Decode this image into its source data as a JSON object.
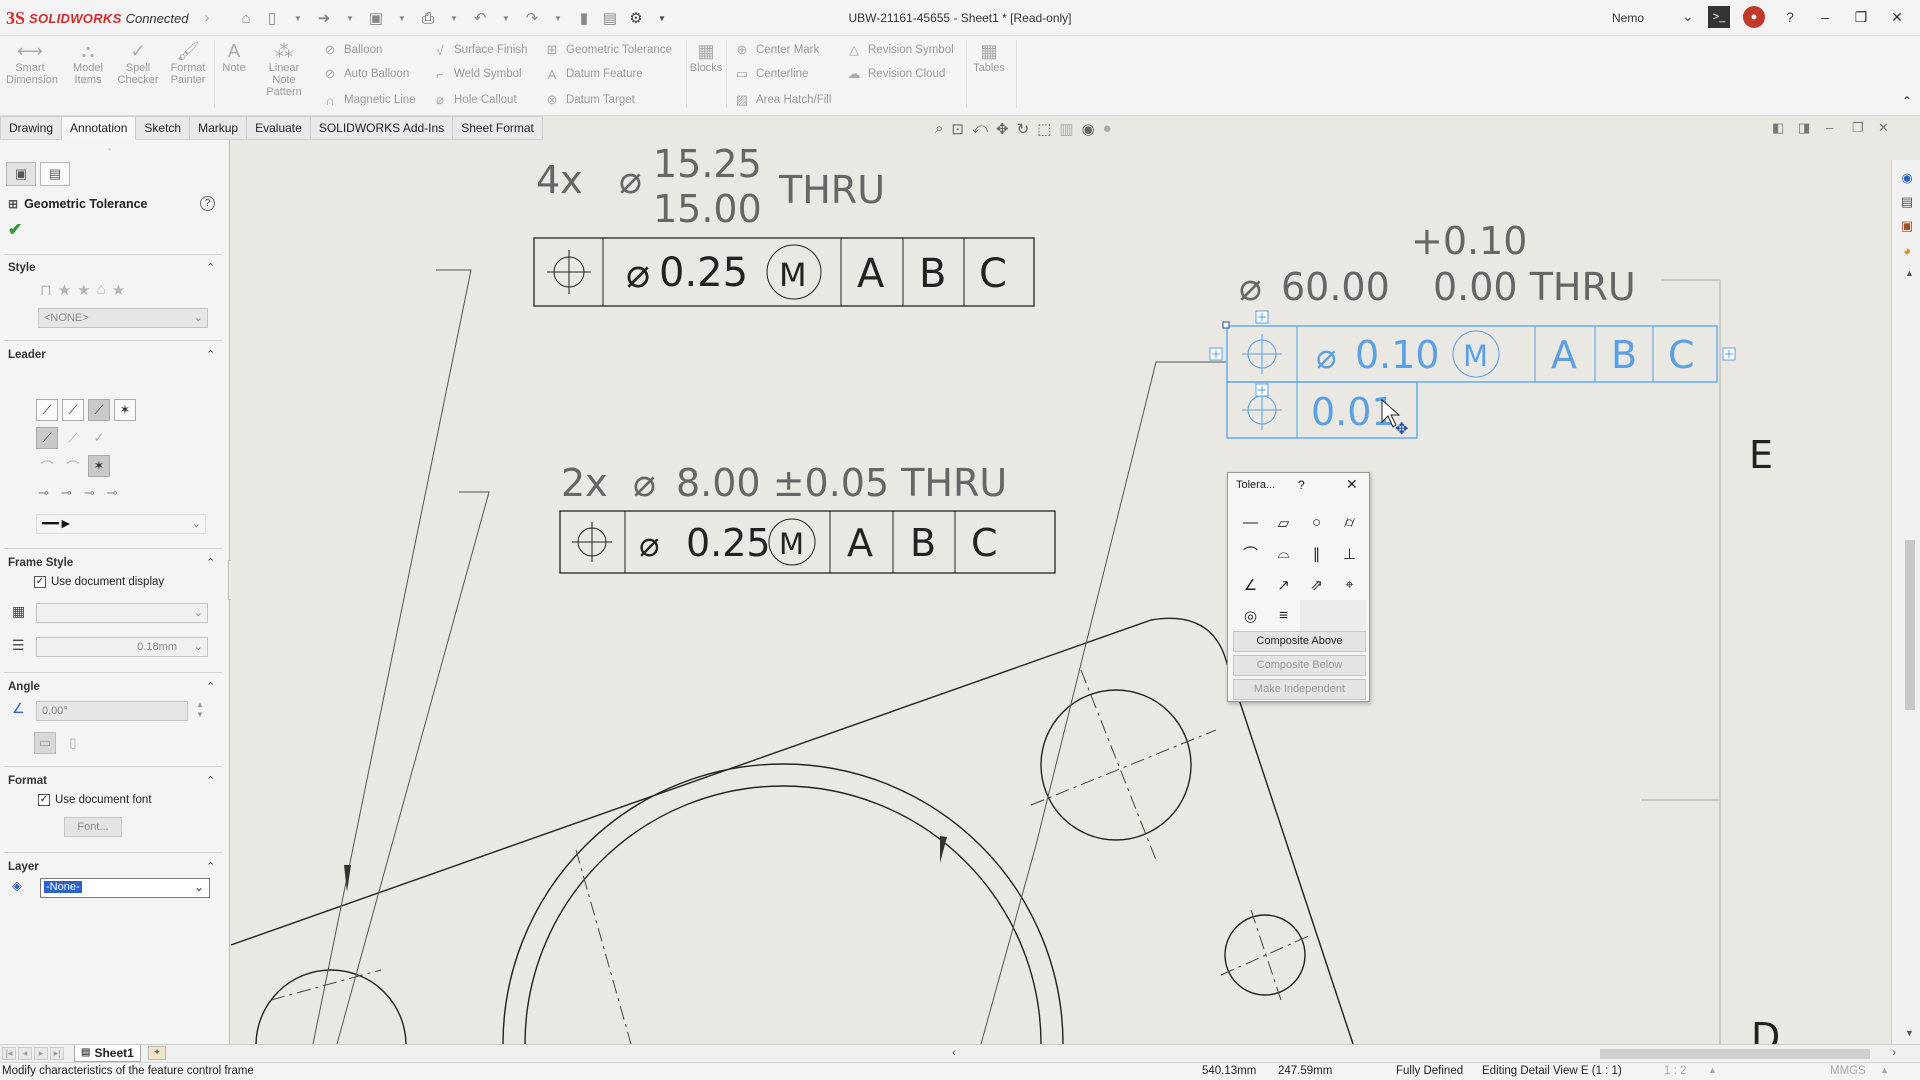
{
  "app": {
    "logo_ds": "3S",
    "logo_solidworks": "SOLIDWORKS",
    "logo_connected": "Connected",
    "doc_title": "UBW-21161-45655 - Sheet1 * [Read-only]",
    "user_name": "Nemo"
  },
  "ribbon": {
    "big": [
      {
        "label": "Smart Dimension",
        "icon": "smart-dimension-icon"
      },
      {
        "label": "Model Items",
        "icon": "model-items-icon"
      },
      {
        "label": "Spell Checker",
        "icon": "spell-checker-icon"
      },
      {
        "label": "Format Painter",
        "icon": "format-painter-icon"
      },
      {
        "label": "Note",
        "icon": "note-icon"
      },
      {
        "label": "Linear Note Pattern",
        "icon": "linear-note-pattern-icon"
      }
    ],
    "col1": [
      "Balloon",
      "Auto Balloon",
      "Magnetic Line"
    ],
    "col2": [
      "Surface Finish",
      "Weld Symbol",
      "Hole Callout"
    ],
    "col3": [
      "Geometric Tolerance",
      "Datum Feature",
      "Datum Target"
    ],
    "blocks": "Blocks",
    "col4": [
      "Center Mark",
      "Centerline",
      "Area Hatch/Fill"
    ],
    "col5": [
      "Revision Symbol",
      "Revision Cloud"
    ],
    "tables": "Tables"
  },
  "tabs": [
    "Drawing",
    "Annotation",
    "Sketch",
    "Markup",
    "Evaluate",
    "SOLIDWORKS Add-Ins",
    "Sheet Format"
  ],
  "active_tab": "Annotation",
  "pm": {
    "title": "Geometric Tolerance",
    "sections": {
      "style": "Style",
      "leader": "Leader",
      "frame_style": "Frame Style",
      "angle": "Angle",
      "format": "Format",
      "layer": "Layer"
    },
    "style_combo": "<NONE>",
    "use_document_display": "Use document display",
    "line_weight": "0.18mm",
    "angle_value": "0.00°",
    "use_document_font": "Use document font",
    "font_button": "Font...",
    "layer_value": "-None-"
  },
  "drawing": {
    "callout1": {
      "prefix": "4x",
      "upper": "15.25",
      "lower": "15.00",
      "suffix": "THRU"
    },
    "fcf1": {
      "tol": "0.25",
      "mod": "M",
      "datums": [
        "A",
        "B",
        "C"
      ]
    },
    "callout2": {
      "text": "2x",
      "value": "8.00 ±0.05 THRU"
    },
    "fcf2": {
      "tol": "0.25",
      "mod": "M",
      "datums": [
        "A",
        "B",
        "C"
      ]
    },
    "callout3": {
      "plus": "+0.10",
      "value": "60.00",
      "minus": "0.00 THRU"
    },
    "fcf3": {
      "tol": "0.10",
      "mod": "M",
      "datums": [
        "A",
        "B",
        "C"
      ],
      "tol2": "0.01"
    },
    "view_letter_e": "E",
    "view_letter_d": "D"
  },
  "tolerance_popup": {
    "title": "Tolera...",
    "help": "?",
    "composite_above": "Composite Above",
    "composite_below": "Composite Below",
    "make_independent": "Make Independent",
    "symbols": [
      "straightness",
      "flatness",
      "circularity",
      "cylindricity",
      "profile-of-line",
      "profile-of-surface",
      "parallelism",
      "perpendicularity",
      "angularity",
      "circular-runout",
      "total-runout",
      "position",
      "concentricity",
      "symmetry"
    ]
  },
  "sheet": {
    "tab": "Sheet1"
  },
  "status": {
    "message": "Modify characteristics of the feature control frame",
    "x": "540.13mm",
    "y": "247.59mm",
    "state": "Fully Defined",
    "editing": "Editing Detail View E (1 : 1)",
    "scale": "1 : 2",
    "units": "MMGS"
  },
  "colors": {
    "brand_red": "#d52a2a",
    "selection_blue": "#5aa0e6",
    "drawing_gray": "#555555",
    "ok_green": "#2c9a2c"
  }
}
